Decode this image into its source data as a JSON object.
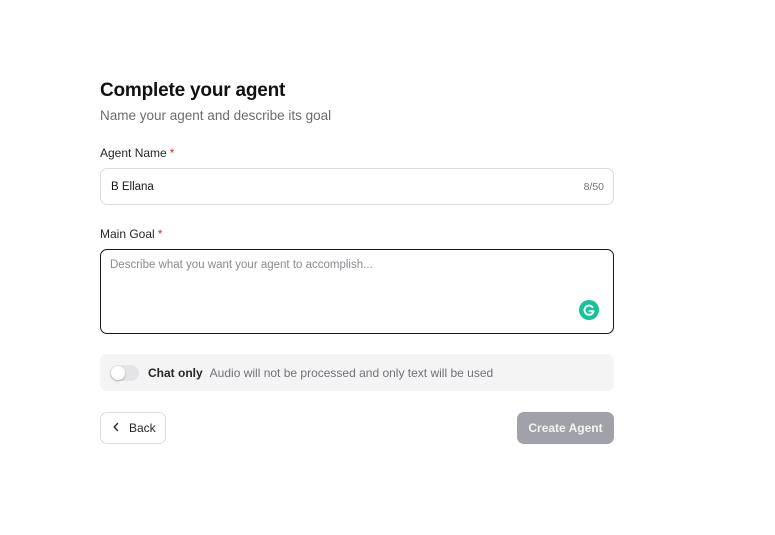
{
  "header": {
    "title": "Complete your agent",
    "subtitle": "Name your agent and describe its goal"
  },
  "agent_name": {
    "label": "Agent Name",
    "required_marker": "*",
    "value": "B Ellana",
    "counter": "8/50"
  },
  "main_goal": {
    "label": "Main Goal",
    "required_marker": "*",
    "value": "",
    "placeholder": "Describe what you want your agent to accomplish..."
  },
  "chat_only": {
    "label": "Chat only",
    "description": "Audio will not be processed and only text will be used",
    "enabled": false
  },
  "actions": {
    "back_label": "Back",
    "create_label": "Create Agent"
  },
  "icons": {
    "back": "chevron-left-icon",
    "grammarly": "grammarly-icon"
  },
  "colors": {
    "required": "#dc2626",
    "grammarly": "#15c39a",
    "create_button_disabled": "#a1a1aa",
    "focused_border": "#18181b"
  }
}
